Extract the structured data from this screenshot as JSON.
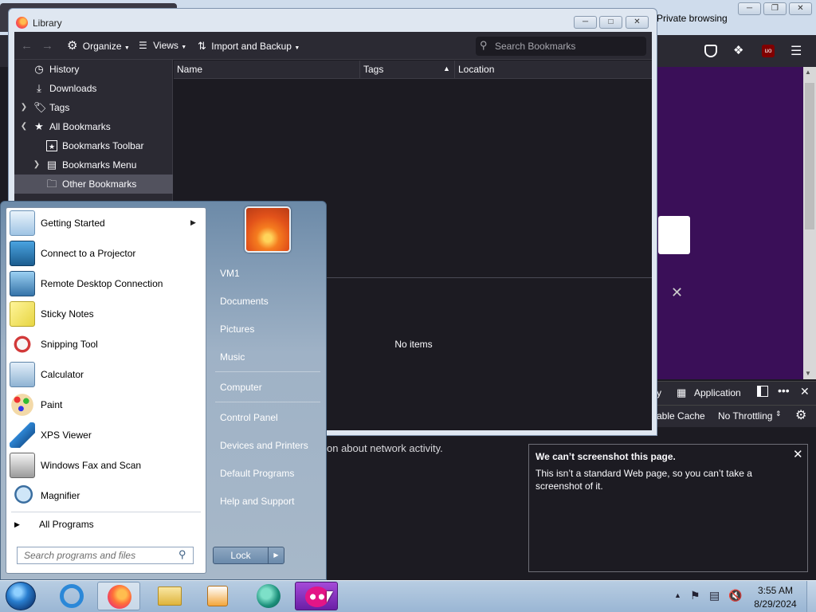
{
  "browser": {
    "private_label": "Private browsing",
    "devtools_tab_partial": "y",
    "devtools_tab_application": "Application",
    "devtools_cache_partial": "able Cache",
    "devtools_throttling": "No Throttling",
    "network_hint_partial": "on about network activity."
  },
  "library": {
    "title": "Library",
    "toolbar": {
      "organize": "Organize",
      "views": "Views",
      "import_backup": "Import and Backup"
    },
    "search_placeholder": "Search Bookmarks",
    "tree": [
      {
        "label": "History"
      },
      {
        "label": "Downloads"
      },
      {
        "label": "Tags"
      },
      {
        "label": "All Bookmarks"
      },
      {
        "label": "Bookmarks Toolbar"
      },
      {
        "label": "Bookmarks Menu"
      },
      {
        "label": "Other Bookmarks"
      }
    ],
    "columns": {
      "name": "Name",
      "tags": "Tags",
      "location": "Location"
    },
    "empty_text": "No items"
  },
  "start_menu": {
    "programs": [
      {
        "label": "Getting Started"
      },
      {
        "label": "Connect to a Projector"
      },
      {
        "label": "Remote Desktop Connection"
      },
      {
        "label": "Sticky Notes"
      },
      {
        "label": "Snipping Tool"
      },
      {
        "label": "Calculator"
      },
      {
        "label": "Paint"
      },
      {
        "label": "XPS Viewer"
      },
      {
        "label": "Windows Fax and Scan"
      },
      {
        "label": "Magnifier"
      }
    ],
    "all_programs": "All Programs",
    "search_placeholder": "Search programs and files",
    "right": [
      {
        "label": "VM1"
      },
      {
        "label": "Documents"
      },
      {
        "label": "Pictures"
      },
      {
        "label": "Music"
      },
      {
        "label": "Computer"
      },
      {
        "label": "Control Panel"
      },
      {
        "label": "Devices and Printers"
      },
      {
        "label": "Default Programs"
      },
      {
        "label": "Help and Support"
      }
    ],
    "lock_label": "Lock"
  },
  "notification": {
    "title": "We can’t screenshot this page.",
    "body": "This isn’t a standard Web page, so you can’t take a screenshot of it."
  },
  "taskbar": {
    "time": "3:55 AM",
    "date": "8/29/2024"
  },
  "colors": {
    "accent_purple": "#3a0f58",
    "dark_bg": "#1c1b22",
    "toolbar_bg": "#2b2a33"
  }
}
